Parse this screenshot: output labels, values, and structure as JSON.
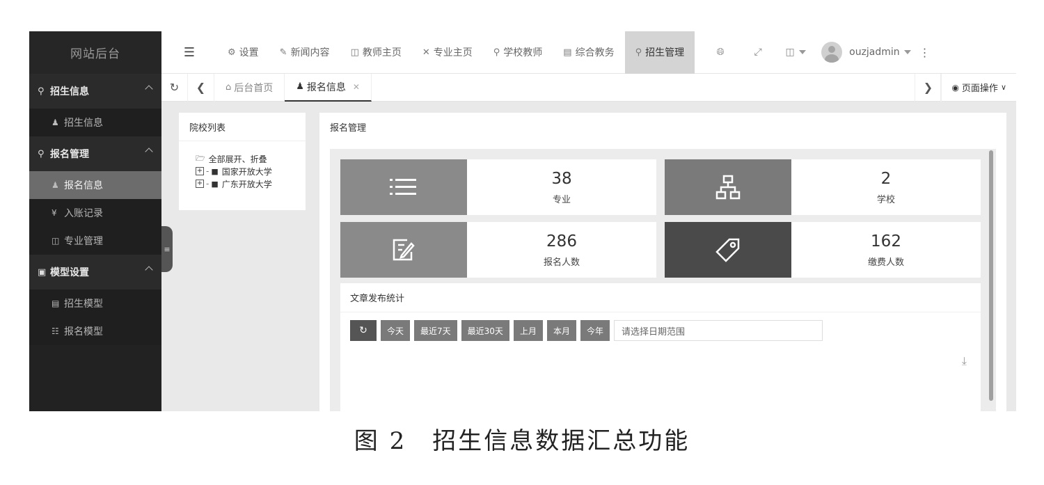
{
  "sidebar": {
    "logo": "网站后台",
    "groups": [
      {
        "label": "招生信息",
        "icon": "user-icon",
        "items": [
          {
            "label": "招生信息",
            "icon": "user-plus-icon"
          }
        ]
      },
      {
        "label": "报名管理",
        "icon": "user-icon",
        "items": [
          {
            "label": "报名信息",
            "icon": "user-icon",
            "active": true
          },
          {
            "label": "入账记录",
            "icon": "yen-icon"
          },
          {
            "label": "专业管理",
            "icon": "book-icon"
          }
        ]
      },
      {
        "label": "模型设置",
        "icon": "settings-box-icon",
        "items": [
          {
            "label": "招生模型",
            "icon": "document-icon"
          },
          {
            "label": "报名模型",
            "icon": "sitemap-icon"
          }
        ]
      }
    ]
  },
  "topnav": {
    "items": [
      "设置",
      "新闻内容",
      "教师主页",
      "专业主页",
      "学校教师",
      "综合教务",
      "招生管理"
    ],
    "active": "招生管理",
    "username": "ouzjadmin"
  },
  "tabbar": {
    "home_tab": "后台首页",
    "active_tab": "报名信息",
    "page_ops": "页面操作"
  },
  "school_panel": {
    "title": "院校列表",
    "expand_all": "全部展开、折叠",
    "schools": [
      "国家开放大学",
      "广东开放大学"
    ]
  },
  "main": {
    "title": "报名管理",
    "stats": {
      "majors": {
        "value": "38",
        "label": "专业",
        "icon": "list-icon"
      },
      "schools": {
        "value": "2",
        "label": "学校",
        "icon": "sitemap-icon"
      },
      "registrants": {
        "value": "286",
        "label": "报名人数",
        "icon": "edit-icon"
      },
      "payers": {
        "value": "162",
        "label": "缴费人数",
        "icon": "tag-icon"
      }
    },
    "article": {
      "title": "文章发布统计",
      "filters": [
        "今天",
        "最近7天",
        "最近30天",
        "上月",
        "本月",
        "今年"
      ],
      "date_placeholder": "请选择日期范围"
    }
  },
  "caption": "图 2　招生信息数据汇总功能",
  "colors": {
    "sidebar": "#222222",
    "active": "#6c6c6c",
    "tile_gray": "#8a8a8a",
    "tile_dark": "#4a4a4a"
  }
}
